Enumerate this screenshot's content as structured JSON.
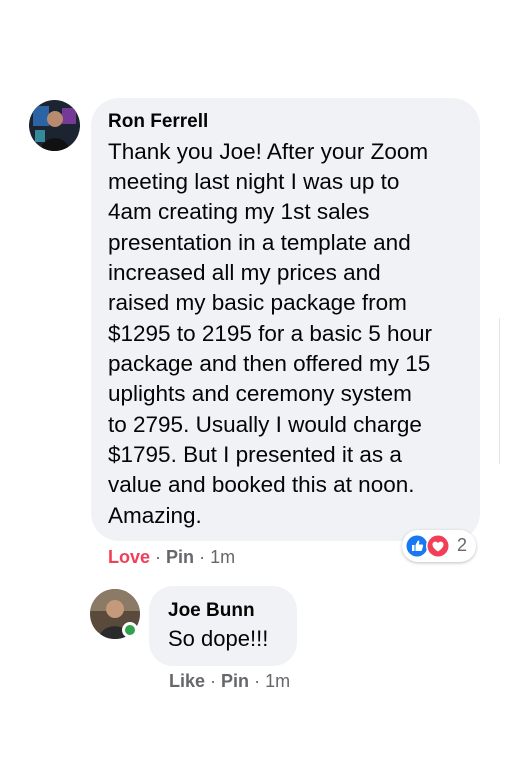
{
  "comments": [
    {
      "author": "Ron Ferrell",
      "lines": [
        "Thank you Joe! After your Zoom",
        "meeting last night I was up to",
        "4am creating my 1st sales",
        "presentation in a template and",
        "increased all my prices and",
        "raised my basic package from",
        "$1295 to 2195 for a basic 5 hour",
        "package and then offered my 15",
        "uplights and ceremony system",
        "to 2795. Usually I would charge",
        "$1795. But I presented it as a",
        "value and booked this at noon.",
        "Amazing."
      ],
      "reaction_label": "Love",
      "pin_label": "Pin",
      "time": "1m",
      "reaction_count": "2",
      "reaction_icons": [
        "like-icon",
        "love-icon"
      ]
    },
    {
      "author": "Joe Bunn",
      "text": "So dope!!!",
      "reaction_label": "Like",
      "pin_label": "Pin",
      "time": "1m",
      "online": true
    }
  ],
  "separator": "·",
  "colors": {
    "bubble": "#f0f2f5",
    "meta": "#65676b",
    "love": "#f33e58",
    "like": "#1877f2",
    "online": "#31a24c"
  }
}
